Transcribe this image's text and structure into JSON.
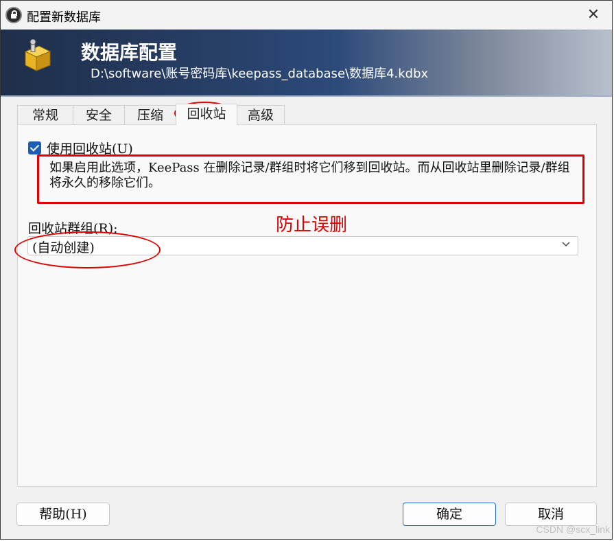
{
  "window": {
    "title": "配置新数据库",
    "close_glyph": "✕"
  },
  "banner": {
    "title": "数据库配置",
    "path": "D:\\software\\账号密码库\\keepass_database\\数据库4.kdbx"
  },
  "tabs": [
    {
      "label": "常规",
      "active": false
    },
    {
      "label": "安全",
      "active": false
    },
    {
      "label": "压缩",
      "active": false
    },
    {
      "label": "回收站",
      "active": true
    },
    {
      "label": "高级",
      "active": false
    }
  ],
  "recycle_bin": {
    "use_checkbox_label": "使用回收站(U)",
    "use_checked": true,
    "description": "如果启用此选项，KeePass 在删除记录/群组时将它们移到回收站。而从回收站里删除记录/群组将永久的移除它们。",
    "group_label": "回收站群组(R):",
    "group_value": "(自动创建)"
  },
  "annotation": {
    "text": "防止误删",
    "color": "#e00000"
  },
  "buttons": {
    "help": "帮助(H)",
    "ok": "确定",
    "cancel": "取消"
  },
  "watermark": "CSDN @scx_link",
  "colors": {
    "accent": "#1a5fb4",
    "annotation": "#e00000"
  }
}
